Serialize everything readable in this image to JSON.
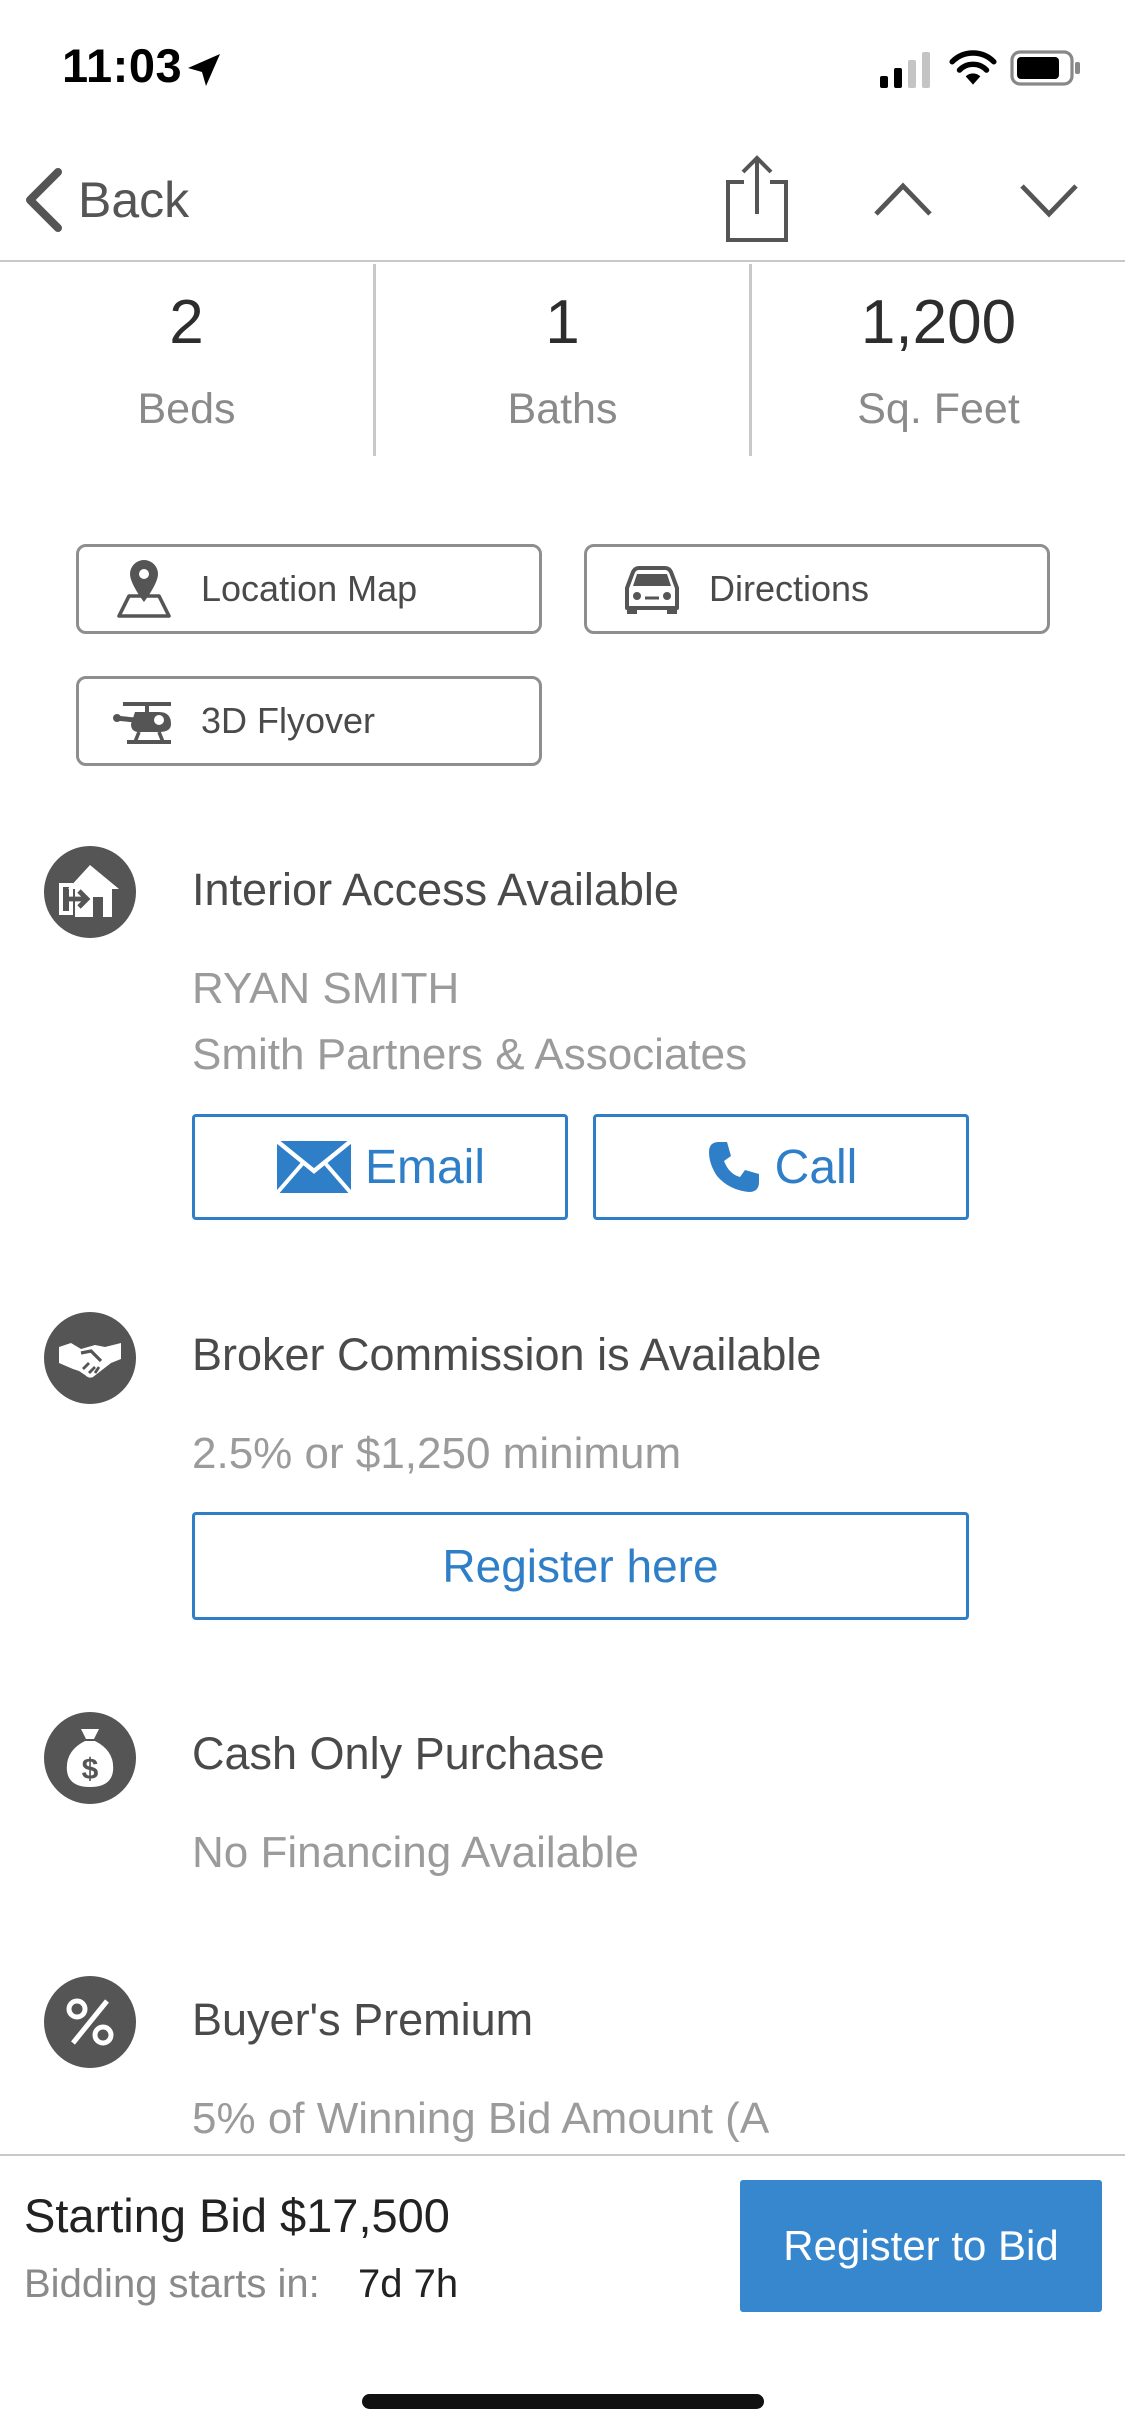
{
  "status_bar": {
    "time": "11:03"
  },
  "nav": {
    "back_label": "Back"
  },
  "stats": [
    {
      "value": "2",
      "label": "Beds"
    },
    {
      "value": "1",
      "label": "Baths"
    },
    {
      "value": "1,200",
      "label": "Sq. Feet"
    }
  ],
  "map_buttons": {
    "location_map": "Location Map",
    "directions": "Directions",
    "flyover": "3D Flyover"
  },
  "interior_access": {
    "title": "Interior Access Available",
    "agent_name": "RYAN SMITH",
    "agent_company": "Smith Partners & Associates",
    "email_label": "Email",
    "call_label": "Call"
  },
  "broker_commission": {
    "title": "Broker Commission is Available",
    "detail": "2.5% or $1,250 minimum",
    "register_label": "Register here"
  },
  "cash_only": {
    "title": "Cash Only Purchase",
    "detail": "No Financing Available"
  },
  "buyers_premium": {
    "title": "Buyer's Premium",
    "detail": "5% of Winning Bid Amount (A"
  },
  "bottom_bar": {
    "starting_bid": "Starting Bid $17,500",
    "bidding_starts_label": "Bidding starts in:",
    "bidding_starts_value": "7d 7h",
    "register_to_bid": "Register to Bid"
  },
  "colors": {
    "accent": "#2f7fc8",
    "primary_button": "#3787cf",
    "icon_circle": "#555555"
  }
}
